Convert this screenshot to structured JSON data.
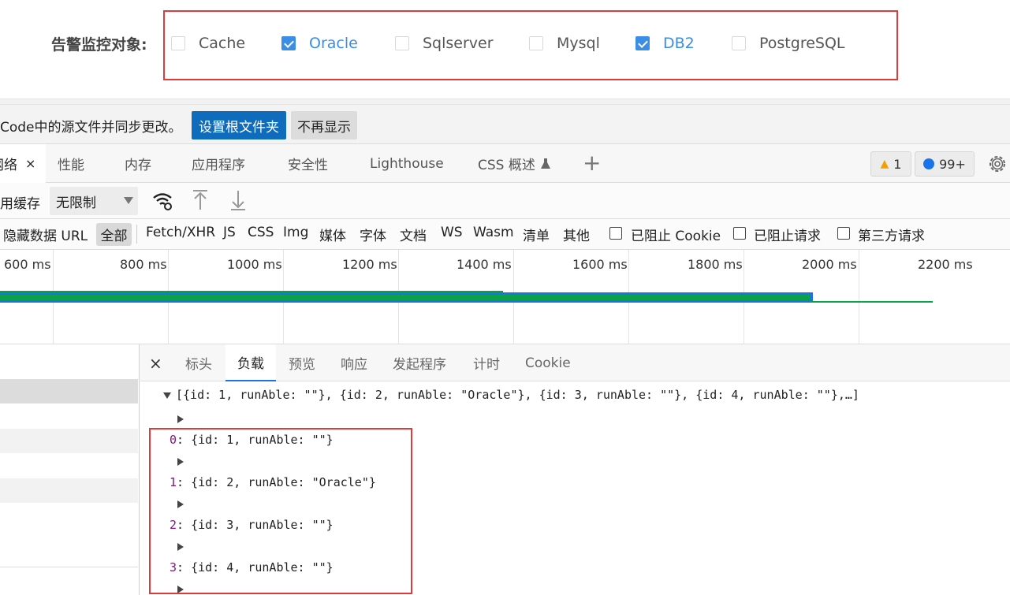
{
  "form": {
    "label": "告警监控对象:",
    "options": [
      {
        "label": "Cache",
        "checked": false
      },
      {
        "label": "Oracle",
        "checked": true
      },
      {
        "label": "Sqlserver",
        "checked": false
      },
      {
        "label": "Mysql",
        "checked": false
      },
      {
        "label": "DB2",
        "checked": true
      },
      {
        "label": "PostgreSQL",
        "checked": false
      }
    ]
  },
  "info_bar": {
    "text": "Code中的源文件并同步更改。",
    "set_root_button": "设置根文件夹",
    "dismiss_button": "不再显示"
  },
  "devtools_tabs": {
    "network": "网络",
    "network_close": "×",
    "performance": "性能",
    "memory": "内存",
    "application": "应用程序",
    "security": "安全性",
    "lighthouse": "Lighthouse",
    "css_overview": "CSS 概述",
    "warnings_count": "1",
    "messages_count": "99+"
  },
  "throttle_toolbar": {
    "cache_label": "用缓存",
    "throttle_value": "无限制"
  },
  "filter_bar": {
    "hide_data_urls": "隐藏数据 URL",
    "all": "全部",
    "types": [
      "Fetch/XHR",
      "JS",
      "CSS",
      "Img",
      "媒体",
      "字体",
      "文档",
      "WS",
      "Wasm",
      "清单",
      "其他"
    ],
    "blocked_cookies": "已阻止 Cookie",
    "blocked_requests": "已阻止请求",
    "third_party": "第三方请求"
  },
  "timeline": {
    "ticks": [
      "600 ms",
      "800 ms",
      "1000 ms",
      "1200 ms",
      "1400 ms",
      "1600 ms",
      "1800 ms",
      "2000 ms",
      "2200 ms"
    ],
    "colors": {
      "blue": "#1a73e8",
      "green": "#0aa14a"
    }
  },
  "detail_tabs": {
    "close": "×",
    "headers": "标头",
    "payload": "负载",
    "preview": "预览",
    "response": "响应",
    "initiator": "发起程序",
    "timing": "计时",
    "cookie": "Cookie"
  },
  "payload": {
    "summary": "[{id: 1, runAble: \"\"}, {id: 2, runAble: \"Oracle\"}, {id: 3, runAble: \"\"}, {id: 4, runAble: \"\"},…]",
    "items": [
      {
        "index": "0",
        "text": "{id: 1, runAble: \"\"}"
      },
      {
        "index": "1",
        "text": "{id: 2, runAble: \"Oracle\"}"
      },
      {
        "index": "2",
        "text": "{id: 3, runAble: \"\"}"
      },
      {
        "index": "3",
        "text": "{id: 4, runAble: \"\"}"
      }
    ]
  },
  "colors": {
    "accent": "#3a8ee6",
    "highlight": "#e03a3a",
    "primary_button": "#0f6cbd"
  }
}
